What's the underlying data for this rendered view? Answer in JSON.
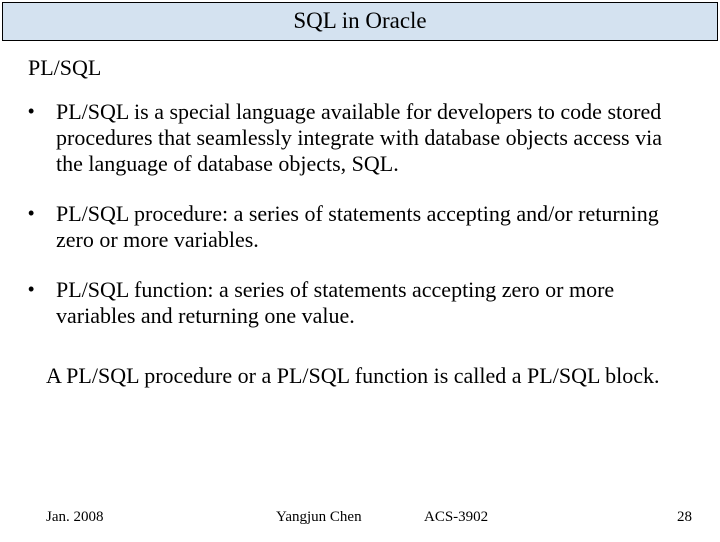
{
  "header": {
    "title": "SQL in Oracle"
  },
  "section": {
    "title": "PL/SQL"
  },
  "bullets": [
    {
      "text": "PL/SQL is a special language available for developers to code stored procedures that seamlessly integrate with database objects access via the language of database objects, SQL."
    },
    {
      "text": "PL/SQL procedure: a series of statements accepting and/or returning zero or more variables."
    },
    {
      "text": "PL/SQL function: a series of statements accepting zero or more variables and returning one value."
    }
  ],
  "closing": {
    "text": "A PL/SQL procedure or a PL/SQL function is called a PL/SQL block."
  },
  "footer": {
    "date": "Jan. 2008",
    "author": "Yangjun Chen",
    "course": "ACS-3902",
    "page": "28"
  }
}
